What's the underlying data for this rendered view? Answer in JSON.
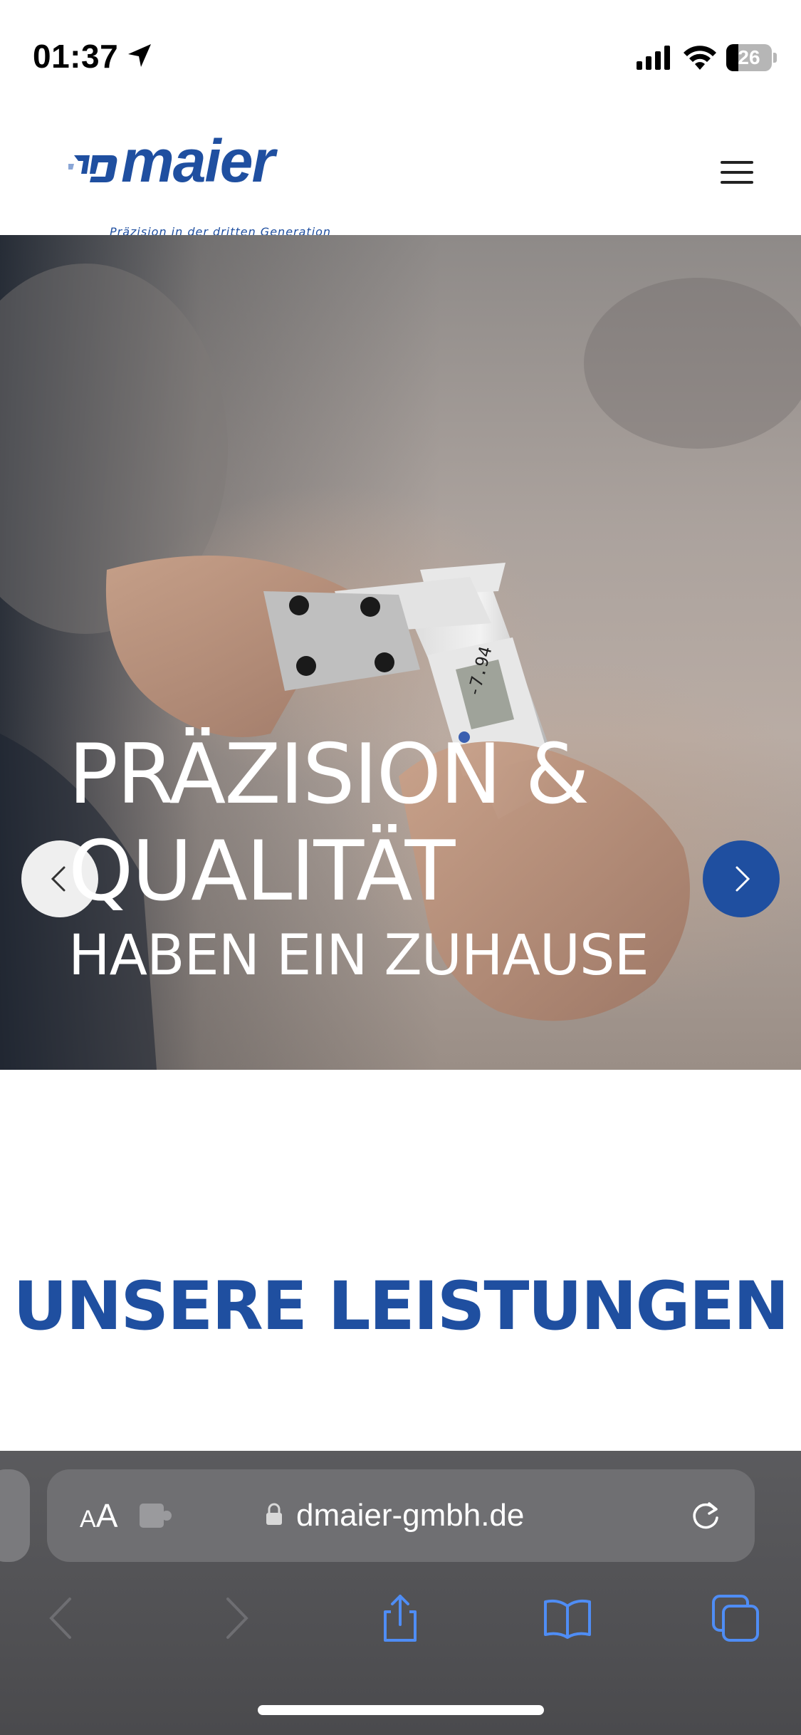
{
  "status_bar": {
    "time": "01:37",
    "battery_level": 26,
    "battery_label": "26"
  },
  "header": {
    "logo_text": "maier",
    "logo_tagline": "Präzision in der dritten Generation",
    "brand_color": "#1f4fa0"
  },
  "hero": {
    "title_line1": "PRÄZISION &",
    "title_line2": "QUALITÄT",
    "subtitle": "HABEN EIN ZUHAUSE",
    "prev_icon": "chevron-left-icon",
    "next_icon": "chevron-right-icon"
  },
  "main": {
    "section_title": "UNSERE LEISTUNGEN"
  },
  "browser": {
    "text_size_small": "A",
    "text_size_big": "A",
    "url": "dmaier-gmbh.de",
    "icons": [
      "puzzle-icon",
      "lock-icon",
      "reload-icon",
      "back-icon",
      "forward-icon",
      "share-icon",
      "bookmarks-icon",
      "tabs-icon"
    ]
  }
}
